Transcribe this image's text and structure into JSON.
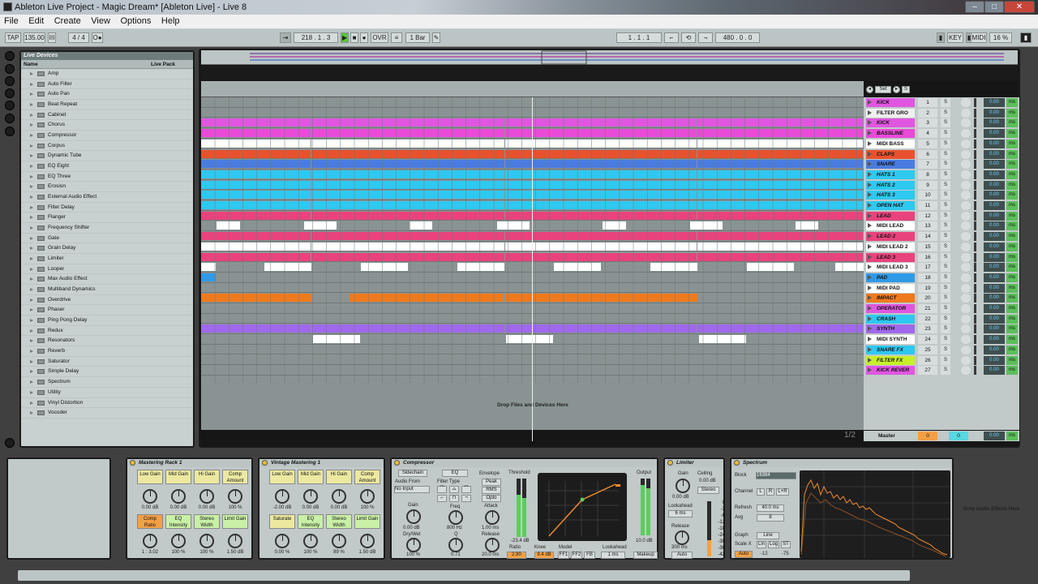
{
  "window": {
    "title": "Ableton Live Project - Magic Dream*  [Ableton Live] - Live 8"
  },
  "menu": [
    "File",
    "Edit",
    "Create",
    "View",
    "Options",
    "Help"
  ],
  "control_bar": {
    "tap": "TAP",
    "tempo": "135.00",
    "bars": "III",
    "signature": "4 / 4",
    "metro": "O●",
    "position": "218 . 1 . 3",
    "ovr": "OVR",
    "quant": "1 Bar",
    "loop_start": "1 . 1 . 1",
    "loop_len": "480 . 0 . 0",
    "key": "KEY",
    "midi": "MIDI",
    "cpu": "16 %"
  },
  "browser": {
    "title": "Live Devices",
    "col_name": "Name",
    "col_pack": "Live Pack",
    "items": [
      "Amp",
      "Auto Filter",
      "Auto Pan",
      "Beat Repeat",
      "Cabinet",
      "Chorus",
      "Compressor",
      "Corpus",
      "Dynamic Tube",
      "EQ Eight",
      "EQ Three",
      "Erosion",
      "External Audio Effect",
      "Filter Delay",
      "Flanger",
      "Frequency Shifter",
      "Gate",
      "Grain Delay",
      "Limiter",
      "Looper",
      "Max Audio Effect",
      "Multiband Dynamics",
      "Overdrive",
      "Phaser",
      "Ping Pong Delay",
      "Redux",
      "Resonators",
      "Reverb",
      "Saturator",
      "Simple Delay",
      "Spectrum",
      "Utility",
      "Vinyl Distortion",
      "Vocoder"
    ]
  },
  "arrangement": {
    "drop_text": "Drop Files and Devices Here",
    "set_label": "Set",
    "half": "1/2",
    "tracks": [
      {
        "name": "KICK",
        "num": "1",
        "color": "#e056e0",
        "clips": []
      },
      {
        "name": "FILTER GRO",
        "num": "2",
        "color": "#f0f0f0",
        "clips": []
      },
      {
        "name": "KICK",
        "num": "3",
        "color": "#e056e0",
        "clips": "full"
      },
      {
        "name": "BASSLINE",
        "num": "4",
        "color": "#e94ad8",
        "clips": "full"
      },
      {
        "name": "MIDI BASS",
        "num": "5",
        "color": "#ffffff",
        "clips": "full"
      },
      {
        "name": "CLAPS",
        "num": "6",
        "color": "#e8512e",
        "clips": "full"
      },
      {
        "name": "SNARE",
        "num": "7",
        "color": "#4a7ce0",
        "clips": "full"
      },
      {
        "name": "HATS 1",
        "num": "8",
        "color": "#2ec8f0",
        "clips": "full"
      },
      {
        "name": "HATS 2",
        "num": "9",
        "color": "#2ec8f0",
        "clips": "full"
      },
      {
        "name": "HATS 3",
        "num": "10",
        "color": "#2ec8f0",
        "clips": "full"
      },
      {
        "name": "OPEN HAT",
        "num": "11",
        "color": "#2ec8f0",
        "clips": "full"
      },
      {
        "name": "LEAD",
        "num": "12",
        "color": "#e8437c",
        "clips": "full"
      },
      {
        "name": "MIDI LEAD",
        "num": "13",
        "color": "#ffffff",
        "clips": "sparse1"
      },
      {
        "name": "LEAD 2",
        "num": "14",
        "color": "#e8437c",
        "clips": "full"
      },
      {
        "name": "MIDI LEAD 2",
        "num": "15",
        "color": "#ffffff",
        "clips": "full"
      },
      {
        "name": "LEAD 3",
        "num": "16",
        "color": "#e8437c",
        "clips": "full"
      },
      {
        "name": "MIDI LEAD 3",
        "num": "17",
        "color": "#ffffff",
        "clips": "sparse2"
      },
      {
        "name": "PAD",
        "num": "18",
        "color": "#2f9ae8",
        "clips": "start"
      },
      {
        "name": "MIDI PAD",
        "num": "19",
        "color": "#ffffff",
        "clips": []
      },
      {
        "name": "IMPACT",
        "num": "20",
        "color": "#ef7a1c",
        "clips": "impact"
      },
      {
        "name": "OPERATOR",
        "num": "21",
        "color": "#e056e0",
        "clips": []
      },
      {
        "name": "CRASH",
        "num": "22",
        "color": "#2ec8f0",
        "clips": []
      },
      {
        "name": "SYNTH",
        "num": "23",
        "color": "#a068ec",
        "clips": "full"
      },
      {
        "name": "MIDI SYNTH",
        "num": "24",
        "color": "#ffffff",
        "clips": "sparse3"
      },
      {
        "name": "SNARE FX",
        "num": "25",
        "color": "#2ec8f0",
        "clips": []
      },
      {
        "name": "FILTER FX",
        "num": "26",
        "color": "#c8f028",
        "clips": []
      },
      {
        "name": "KICK REVER",
        "num": "27",
        "color": "#e056e0",
        "clips": []
      }
    ],
    "master": {
      "name": "Master",
      "val1": "0",
      "val2": "0"
    },
    "vol_text": "0.00",
    "ms_text": "ms",
    "s_label": "S"
  },
  "devices": {
    "rack1": {
      "title": "Mastering Rack 1",
      "macros": [
        "Low Gain",
        "Mid Gain",
        "Hi Gain",
        "Comp Amount",
        "Comp Ratio",
        "EQ Intensity",
        "Stereo Width",
        "Limit Gain"
      ],
      "values": [
        "0.00 dB",
        "0.00 dB",
        "0.00 dB",
        "100 %",
        "1 : 3.02",
        "100 %",
        "100 %",
        "1.50 dB"
      ]
    },
    "rack2": {
      "title": "Vintage Mastering 1",
      "macros": [
        "Low Gain",
        "Mid Gain",
        "Hi Gain",
        "Comp Amount",
        "Saturate",
        "EQ Intensity",
        "Stereo Width",
        "Limit Gain"
      ],
      "values": [
        "-2.00 dB",
        "0.00 dB",
        "0.00 dB",
        "100 %",
        "0.00 %",
        "100 %",
        "89 %",
        "1.50 dB"
      ]
    },
    "compressor": {
      "title": "Compressor",
      "sidechain": "Sidechain",
      "eq": "EQ",
      "audio_from": "Audio From",
      "no_input": "No Input",
      "gain": "Gain",
      "gain_val": "0.00 dB",
      "drywet": "Dry/Wet",
      "drywet_val": "100 %",
      "filter_type": "Filter Type",
      "freq": "Freq",
      "freq_val": "800 Hz",
      "q": "Q",
      "q_val": "0.71",
      "envelope": "Envelope",
      "peak": "Peak",
      "rms": "RMS",
      "opto": "Opto",
      "attack": "Attack",
      "attack_val": "1.00 ms",
      "release": "Release",
      "release_val": "20.0 ms",
      "threshold": "Threshold",
      "thr_val": "-23.4 dB",
      "output": "Output",
      "out_val": "10.0 dB",
      "ratio": "Ratio",
      "ratio_val": "2.90",
      "knee": "Knee",
      "knee_val": "9.4 dB",
      "model": "Model",
      "ff1": "FF1",
      "ff2": "FF2",
      "fb": "FB",
      "lookahead": "Lookahead",
      "look_val": "1 ms",
      "makeup": "Makeup"
    },
    "limiter": {
      "title": "Limiter",
      "gain": "Gain",
      "gain_val": "0.00 dB",
      "ceiling": "Ceiling",
      "ceil_val": "0.00 dB",
      "stereo": "Stereo",
      "lookahead": "Lookahead",
      "look_val": "6 ms",
      "release": "Release",
      "rel_val": "300 ms",
      "auto": "Auto",
      "scale": [
        "0",
        "-3",
        "-6",
        "-12",
        "-18",
        "-24",
        "-30",
        "-36",
        "-42"
      ]
    },
    "spectrum": {
      "title": "Spectrum",
      "block": "Block",
      "block_val": "16384",
      "channel": "Channel",
      "ch_L": "L",
      "ch_R": "R",
      "ch_LR": "L+R",
      "refresh": "Refresh",
      "refresh_val": "40.0 ms",
      "avg": "Avg",
      "avg_val": "8",
      "graph": "Graph",
      "line": "Line",
      "scale_x": "Scale X",
      "lin": "Lin",
      "log": "Log",
      "st": "ST",
      "auto": "Auto",
      "lo": "-12",
      "hi": "-75"
    },
    "drop_effects": "Drop Audio Effects Here"
  }
}
